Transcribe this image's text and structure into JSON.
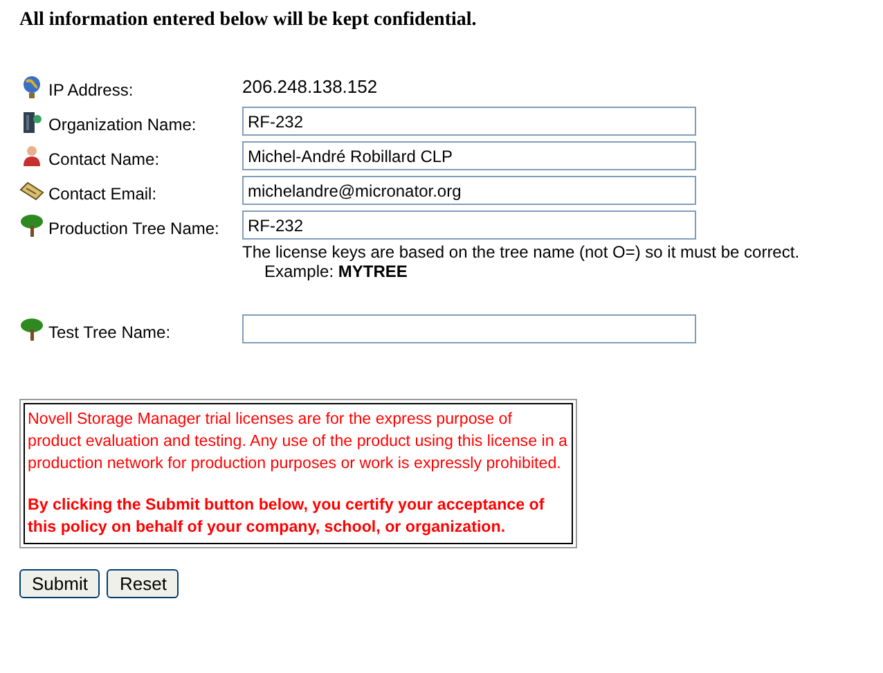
{
  "heading": "All information entered below will be kept confidential.",
  "fields": [
    {
      "kind": "static",
      "label": "IP Address:",
      "value": "206.248.138.152"
    },
    {
      "kind": "input",
      "label": "Organization Name:",
      "value": "RF-232"
    },
    {
      "kind": "input",
      "label": "Contact Name:",
      "value": "Michel-André Robillard CLP"
    },
    {
      "kind": "input",
      "label": "Contact Email:",
      "value": "michelandre@micronator.org"
    },
    {
      "kind": "input",
      "label": "Production Tree Name:",
      "value": "RF-232",
      "hints": [
        "The license keys are based on the tree name (not O=) so it must be correct.",
        "Example: **MYTREE**"
      ]
    },
    {
      "kind": "input",
      "label": "Test Tree Name:"
    }
  ],
  "notice": [
    "Novell Storage Manager trial licenses are for the express purpose of product evaluation and testing. Any use of the product using this license in a production network for production purposes or work is expressly prohibited.",
    "By clicking the Submit button below, you certify your acceptance of this policy on behalf of your company, school, or organization."
  ],
  "buttons": [
    "Submit",
    "Reset"
  ]
}
